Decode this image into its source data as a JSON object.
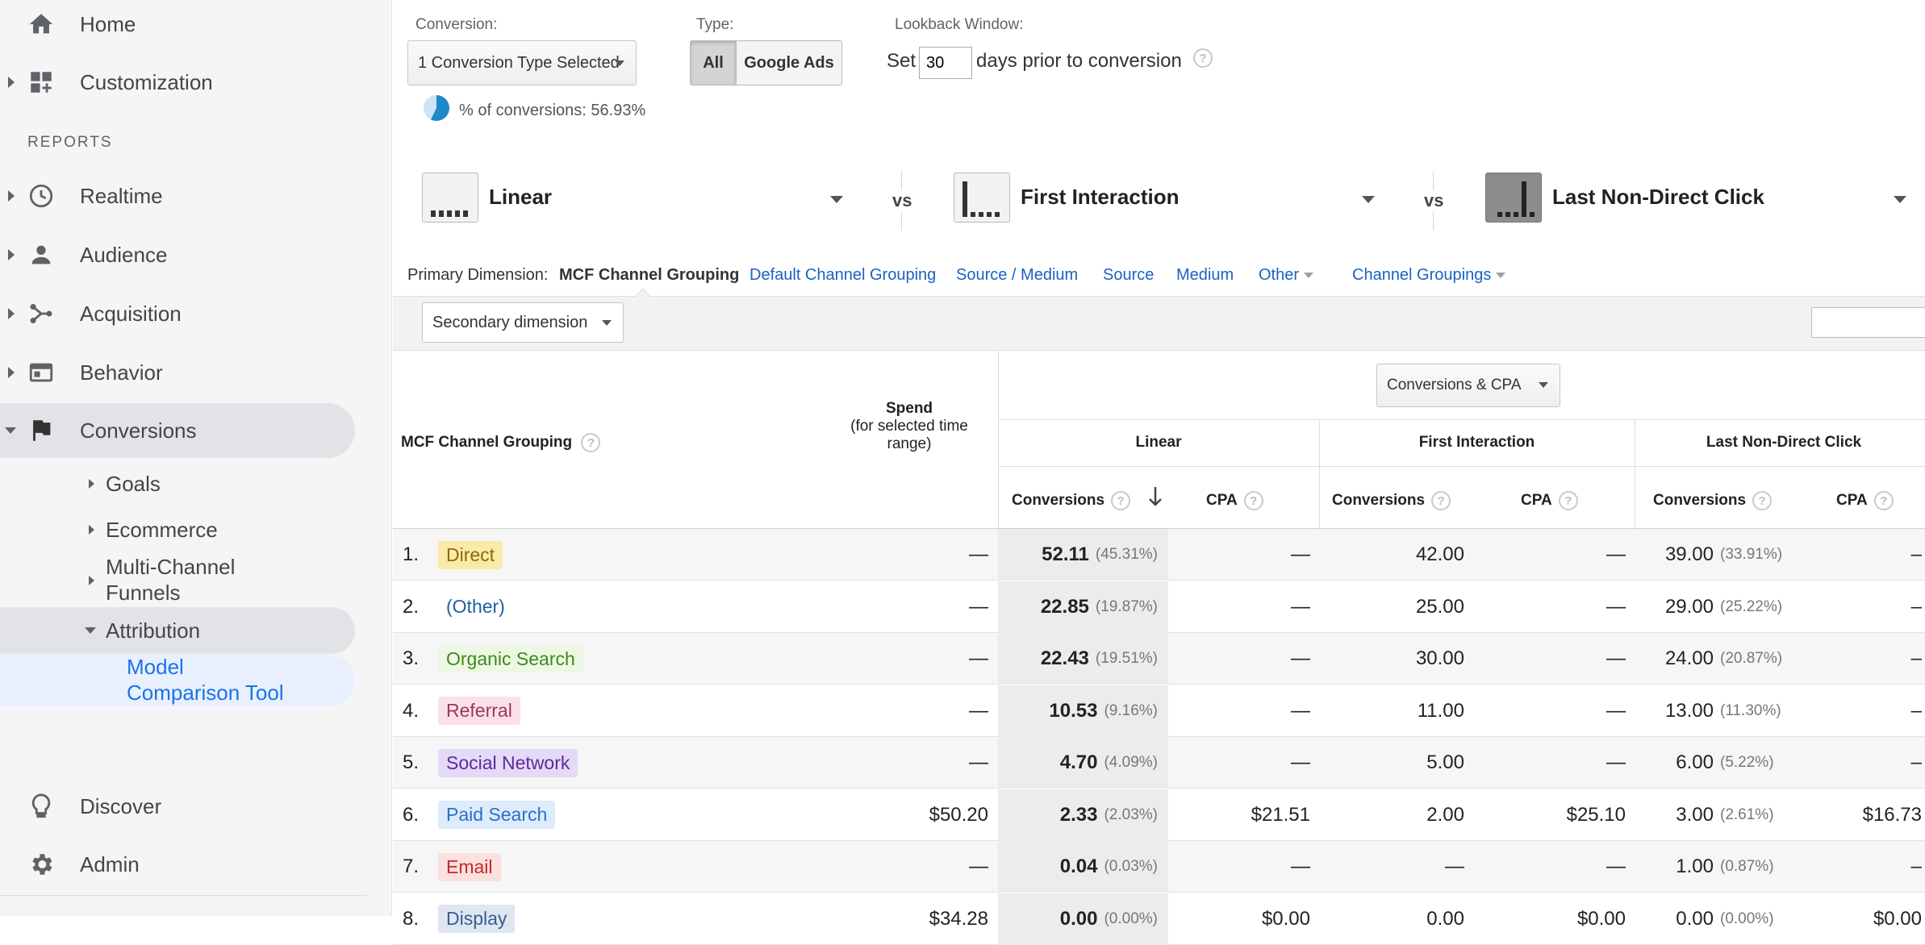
{
  "sidebar": {
    "home": "Home",
    "customization": "Customization",
    "reports_header": "REPORTS",
    "realtime": "Realtime",
    "audience": "Audience",
    "acquisition": "Acquisition",
    "behavior": "Behavior",
    "conversions": "Conversions",
    "goals": "Goals",
    "ecommerce": "Ecommerce",
    "mcf_line1": "Multi-Channel",
    "mcf_line2": "Funnels",
    "attribution": "Attribution",
    "model_line1": "Model",
    "model_line2": "Comparison Tool",
    "discover": "Discover",
    "admin": "Admin"
  },
  "controls": {
    "conversion_label": "Conversion:",
    "conversion_value": "1 Conversion Type Selected",
    "pct_conversions": "% of conversions: 56.93%",
    "type_label": "Type:",
    "type_all": "All",
    "type_ads": "Google Ads",
    "lookback_label": "Lookback Window:",
    "set": "Set",
    "days_value": "30",
    "days_suffix": "days prior to conversion"
  },
  "models": {
    "m1": "Linear",
    "m2": "First Interaction",
    "m3": "Last Non-Direct Click",
    "vs": "vs"
  },
  "dimension": {
    "label": "Primary Dimension:",
    "active": "MCF Channel Grouping",
    "links": [
      "Default Channel Grouping",
      "Source / Medium",
      "Source",
      "Medium",
      "Other",
      "Channel Groupings"
    ],
    "secondary": "Secondary dimension"
  },
  "table": {
    "metric_select": "Conversions & CPA",
    "col_grouping": "MCF Channel Grouping",
    "spend_line1": "Spend",
    "spend_line2": "(for selected time",
    "spend_line3": "range)",
    "model_headers": [
      "Linear",
      "First Interaction",
      "Last Non-Direct Click"
    ],
    "conversions": "Conversions",
    "cpa": "CPA",
    "rows": [
      {
        "num": "1.",
        "name": "Direct",
        "bg": "#fbe9a8",
        "fg": "#8a6d00",
        "spend": "—",
        "lin": "52.11",
        "lin_pct": "(45.31%)",
        "lin_cpa": "—",
        "fi": "42.00",
        "fi_cpa": "—",
        "ln": "39.00",
        "ln_pct": "(33.91%)",
        "ln_cpa": "–"
      },
      {
        "num": "2.",
        "name": "(Other)",
        "bg": "",
        "fg": "#1f5f9f",
        "spend": "—",
        "lin": "22.85",
        "lin_pct": "(19.87%)",
        "lin_cpa": "—",
        "fi": "25.00",
        "fi_cpa": "—",
        "ln": "29.00",
        "ln_pct": "(25.22%)",
        "ln_cpa": "–"
      },
      {
        "num": "3.",
        "name": "Organic Search",
        "bg": "#eef7e4",
        "fg": "#3c8a1c",
        "spend": "—",
        "lin": "22.43",
        "lin_pct": "(19.51%)",
        "lin_cpa": "—",
        "fi": "30.00",
        "fi_cpa": "—",
        "ln": "24.00",
        "ln_pct": "(20.87%)",
        "ln_cpa": "–"
      },
      {
        "num": "4.",
        "name": "Referral",
        "bg": "#fbe0ea",
        "fg": "#9b3a58",
        "spend": "—",
        "lin": "10.53",
        "lin_pct": "(9.16%)",
        "lin_cpa": "—",
        "fi": "11.00",
        "fi_cpa": "—",
        "ln": "13.00",
        "ln_pct": "(11.30%)",
        "ln_cpa": "–"
      },
      {
        "num": "5.",
        "name": "Social Network",
        "bg": "#e4d9f7",
        "fg": "#5b2a9c",
        "spend": "—",
        "lin": "4.70",
        "lin_pct": "(4.09%)",
        "lin_cpa": "—",
        "fi": "5.00",
        "fi_cpa": "—",
        "ln": "6.00",
        "ln_pct": "(5.22%)",
        "ln_cpa": "–"
      },
      {
        "num": "6.",
        "name": "Paid Search",
        "bg": "#ddebfb",
        "fg": "#2a6fc9",
        "spend": "$50.20",
        "lin": "2.33",
        "lin_pct": "(2.03%)",
        "lin_cpa": "$21.51",
        "fi": "2.00",
        "fi_cpa": "$25.10",
        "ln": "3.00",
        "ln_pct": "(2.61%)",
        "ln_cpa": "$16.73"
      },
      {
        "num": "7.",
        "name": "Email",
        "bg": "#fbe0e0",
        "fg": "#c62828",
        "spend": "—",
        "lin": "0.04",
        "lin_pct": "(0.03%)",
        "lin_cpa": "—",
        "fi": "—",
        "fi_cpa": "—",
        "ln": "1.00",
        "ln_pct": "(0.87%)",
        "ln_cpa": "–"
      },
      {
        "num": "8.",
        "name": "Display",
        "bg": "#dfe6f2",
        "fg": "#3b5d8f",
        "spend": "$34.28",
        "lin": "0.00",
        "lin_pct": "(0.00%)",
        "lin_cpa": "$0.00",
        "fi": "0.00",
        "fi_cpa": "$0.00",
        "ln": "0.00",
        "ln_pct": "(0.00%)",
        "ln_cpa": "$0.00"
      }
    ]
  }
}
